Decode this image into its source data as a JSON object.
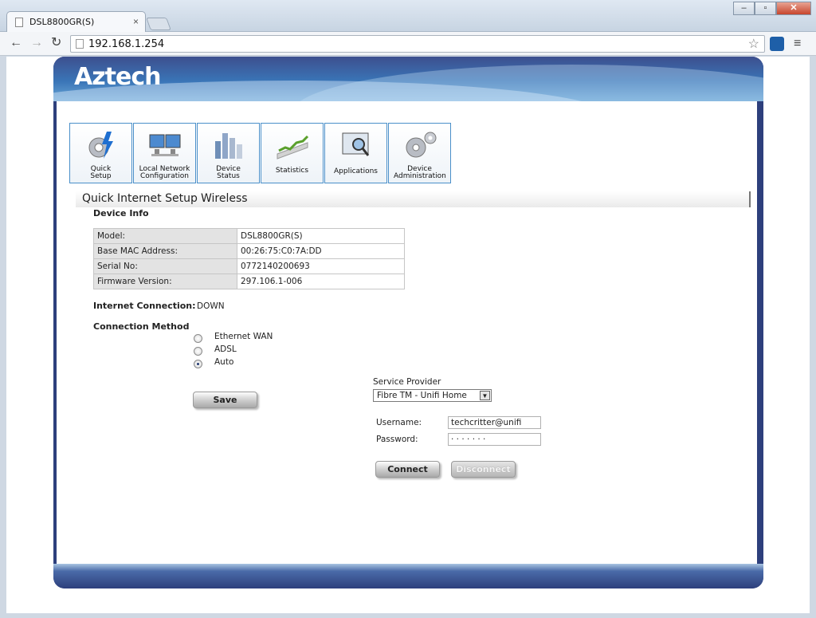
{
  "browser": {
    "tab_title": "DSL8800GR(S)",
    "tab_close": "×",
    "url": "192.168.1.254",
    "window_buttons": [
      "–",
      "▫",
      "✕"
    ]
  },
  "brand": {
    "logo": "Aztech"
  },
  "nav_tabs": [
    {
      "label": "Quick Setup",
      "icon": "gear-lightning-icon"
    },
    {
      "label": "Local Network Configuration",
      "icon": "monitors-icon"
    },
    {
      "label": "Device Status",
      "icon": "bar-chart-icon"
    },
    {
      "label": "Statistics",
      "icon": "graph-icon"
    },
    {
      "label": "Applications",
      "icon": "magnifier-screen-icon"
    },
    {
      "label": "Device Administration",
      "icon": "gears-icon"
    }
  ],
  "submenu": [
    "Quick Internet Setup",
    "Wireless"
  ],
  "device_info": {
    "heading": "Device Info",
    "rows": [
      {
        "label": "Model:",
        "value": "DSL8800GR(S)"
      },
      {
        "label": "Base MAC Address:",
        "value": "00:26:75:C0:7A:DD"
      },
      {
        "label": "Serial No:",
        "value": "0772140200693"
      },
      {
        "label": "Firmware Version:",
        "value": "297.106.1-006"
      }
    ]
  },
  "internet": {
    "label": "Internet Connection:",
    "status": "DOWN"
  },
  "connection": {
    "heading": "Connection Method",
    "options": [
      "Ethernet WAN",
      "ADSL",
      "Auto"
    ],
    "selected": "Auto",
    "save_label": "Save"
  },
  "provider": {
    "label": "Service Provider",
    "selected": "Fibre TM - Unifi Home",
    "username_label": "Username:",
    "username": "techcritter@unifi",
    "password_label": "Password:",
    "password": "· · · · · · ·",
    "connect_label": "Connect",
    "disconnect_label": "Disconnect"
  }
}
